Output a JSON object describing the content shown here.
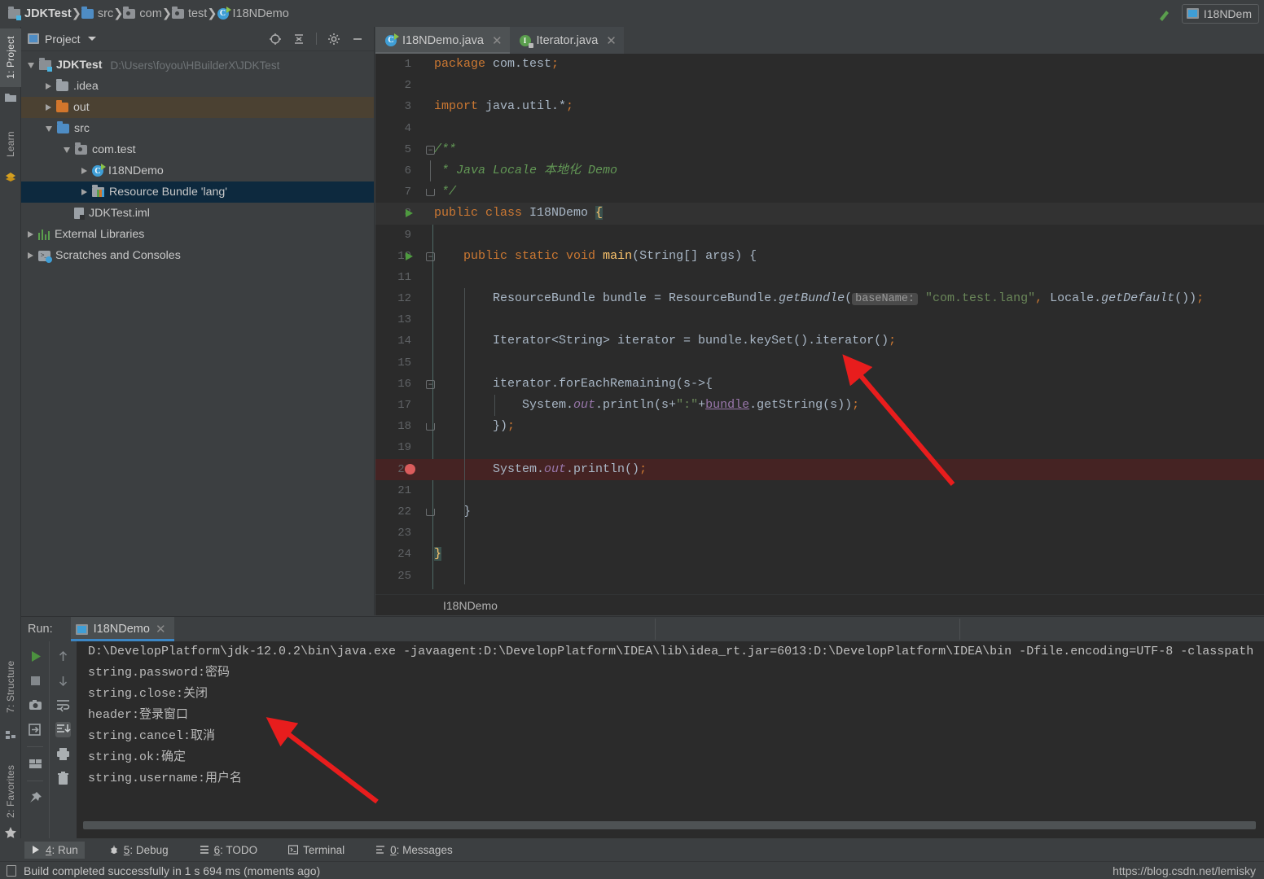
{
  "breadcrumb": {
    "items": [
      {
        "label": "JDKTest",
        "icon": "module-icon",
        "bold": true
      },
      {
        "label": "src",
        "icon": "folder-icon"
      },
      {
        "label": "com",
        "icon": "package-icon"
      },
      {
        "label": "test",
        "icon": "package-icon"
      },
      {
        "label": "I18NDemo",
        "icon": "java-class-icon"
      }
    ],
    "run_config": "I18NDem"
  },
  "left_strip": {
    "project": "1: Project",
    "learn": "Learn",
    "structure": "7: Structure",
    "favorites": "2: Favorites"
  },
  "project_panel": {
    "title": "Project",
    "actions": [
      "locate-icon",
      "collapse-all-icon",
      "gear-icon",
      "minimize-icon"
    ],
    "tree": [
      {
        "label": "JDKTest",
        "path": "D:\\Users\\foyou\\HBuilderX\\JDKTest",
        "icon": "module-icon",
        "indent": 0,
        "state": "open",
        "bold": true
      },
      {
        "label": ".idea",
        "icon": "folder-grey-icon",
        "indent": 1,
        "state": "closed"
      },
      {
        "label": "out",
        "icon": "folder-orange-icon",
        "indent": 1,
        "state": "closed",
        "highlight": "out"
      },
      {
        "label": "src",
        "icon": "folder-blue-icon",
        "indent": 1,
        "state": "open"
      },
      {
        "label": "com.test",
        "icon": "package-icon",
        "indent": 2,
        "state": "open"
      },
      {
        "label": "I18NDemo",
        "icon": "java-class-icon",
        "indent": 3,
        "state": "closed"
      },
      {
        "label": "Resource Bundle 'lang'",
        "icon": "resource-bundle-icon",
        "indent": 3,
        "state": "closed",
        "highlight": "selected"
      },
      {
        "label": "JDKTest.iml",
        "icon": "iml-file-icon",
        "indent": 1,
        "state": "none"
      },
      {
        "label": "External Libraries",
        "icon": "library-icon",
        "indent": 0,
        "state": "closed"
      },
      {
        "label": "Scratches and Consoles",
        "icon": "scratches-icon",
        "indent": 0,
        "state": "closed"
      }
    ]
  },
  "editor": {
    "tabs": [
      {
        "label": "I18NDemo.java",
        "icon": "java-class-icon",
        "active": true
      },
      {
        "label": "Iterator.java",
        "icon": "java-interface-icon",
        "active": false
      }
    ],
    "breadcrumb": "I18NDemo",
    "lines": [
      {
        "n": "1",
        "html": "<span class='kw'>package</span> com.test<span class='kw'>;</span>"
      },
      {
        "n": "2",
        "html": ""
      },
      {
        "n": "3",
        "html": "<span class='kw'>import</span> java.util.*<span class='kw'>;</span>"
      },
      {
        "n": "4",
        "html": ""
      },
      {
        "n": "5",
        "html": "<span class='cmt'>/**</span>"
      },
      {
        "n": "6",
        "html": "<span class='cmt'> * Java Locale 本地化 Demo</span>"
      },
      {
        "n": "7",
        "html": "<span class='cmt'> */</span>"
      },
      {
        "n": "8",
        "html": "<span class='kw'>public class</span> I18NDemo <span class='brace-hl'>{</span>"
      },
      {
        "n": "9",
        "html": ""
      },
      {
        "n": "10",
        "html": "    <span class='kw'>public static void</span> <span class='mth'>main</span>(String[] args) {"
      },
      {
        "n": "11",
        "html": ""
      },
      {
        "n": "12",
        "html": "        ResourceBundle bundle = ResourceBundle.<span class='ital'>getBundle</span>(<span class='hint'>baseName:</span> <span class='str'>\"com.test.lang\"</span><span class='kw'>,</span> Locale.<span class='ital'>getDefault</span>())<span class='kw'>;</span>"
      },
      {
        "n": "13",
        "html": ""
      },
      {
        "n": "14",
        "html": "        Iterator&lt;String&gt; iterator = bundle.keySet().iterator()<span class='kw'>;</span>"
      },
      {
        "n": "15",
        "html": ""
      },
      {
        "n": "16",
        "html": "        iterator.forEachRemaining(s-&gt;{"
      },
      {
        "n": "17",
        "html": "            System.<span class='fld'>out</span>.println(s+<span class='str'>\":\"</span>+<span class='ul'>bundle</span>.getString(s))<span class='kw'>;</span>"
      },
      {
        "n": "18",
        "html": "        })<span class='kw'>;</span>"
      },
      {
        "n": "19",
        "html": ""
      },
      {
        "n": "20",
        "html": "        System.<span class='fld'>out</span>.println()<span class='kw'>;</span>"
      },
      {
        "n": "21",
        "html": ""
      },
      {
        "n": "22",
        "html": "    }"
      },
      {
        "n": "23",
        "html": ""
      },
      {
        "n": "24",
        "html": "<span class='brace-hl'>}</span>"
      },
      {
        "n": "25",
        "html": ""
      }
    ]
  },
  "run_panel": {
    "label": "Run:",
    "tab": "I18NDemo",
    "console_lines": [
      "D:\\DevelopPlatform\\jdk-12.0.2\\bin\\java.exe -javaagent:D:\\DevelopPlatform\\IDEA\\lib\\idea_rt.jar=6013:D:\\DevelopPlatform\\IDEA\\bin -Dfile.encoding=UTF-8 -classpath",
      "string.password:密码",
      "string.close:关闭",
      "header:登录窗口",
      "string.cancel:取消",
      "string.ok:确定",
      "string.username:用户名"
    ]
  },
  "bottom_bar": {
    "buttons": [
      {
        "num": "4",
        "label": ": Run",
        "icon": "play-icon",
        "selected": true
      },
      {
        "num": "5",
        "label": ": Debug",
        "icon": "bug-icon",
        "selected": false
      },
      {
        "num": "6",
        "label": ": TODO",
        "icon": "list-icon",
        "selected": false
      },
      {
        "num": "",
        "label": "Terminal",
        "icon": "terminal-icon",
        "selected": false
      },
      {
        "num": "0",
        "label": ": Messages",
        "icon": "messages-icon",
        "selected": false
      }
    ]
  },
  "status_bar": {
    "message": "Build completed successfully in 1 s 694 ms (moments ago)",
    "watermark": "https://blog.csdn.net/lemisky"
  },
  "colors": {
    "panel_bg": "#3c3f41",
    "editor_bg": "#2b2b2b",
    "accent_blue": "#3c86c4",
    "selection": "#0d293e",
    "out_highlight": "#4b4132",
    "keyword": "#cc7832",
    "string": "#6a8759",
    "comment": "#629755",
    "arrow_red": "#e81d1d"
  }
}
